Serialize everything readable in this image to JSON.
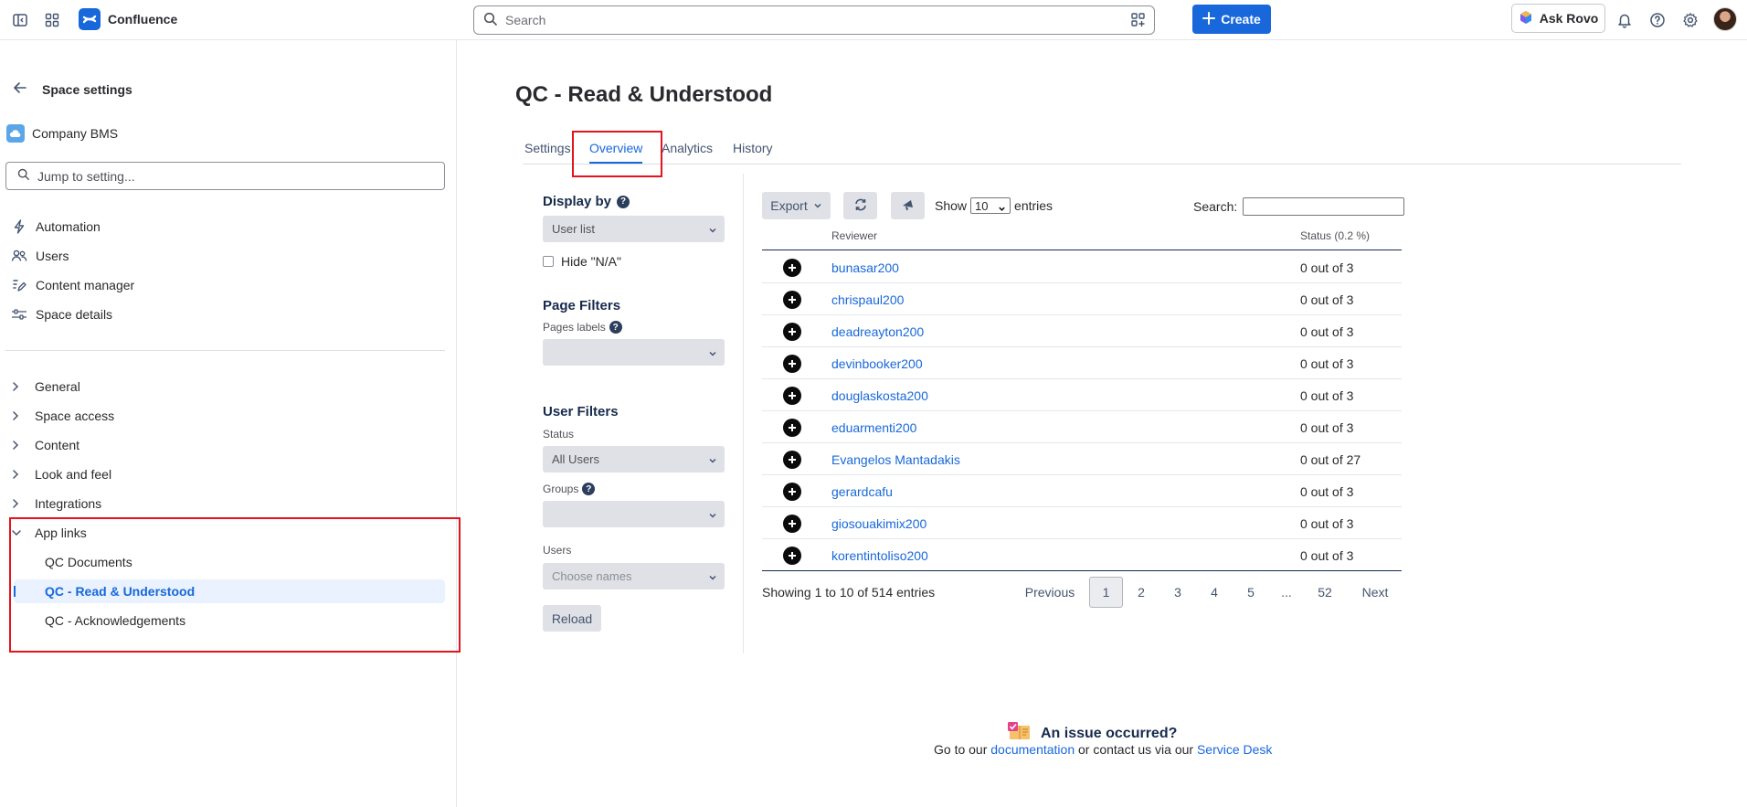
{
  "topbar": {
    "app_name": "Confluence",
    "search_placeholder": "Search",
    "create_label": "Create",
    "rovo_label": "Ask Rovo"
  },
  "sidebar": {
    "back_title": "Space settings",
    "space_name": "Company BMS",
    "jump_placeholder": "Jump to setting...",
    "items": [
      {
        "label": "Automation",
        "icon": "lightning-icon"
      },
      {
        "label": "Users",
        "icon": "people-icon"
      },
      {
        "label": "Content manager",
        "icon": "content-edit-icon"
      },
      {
        "label": "Space details",
        "icon": "sliders-icon"
      }
    ],
    "groups": [
      {
        "label": "General"
      },
      {
        "label": "Space access"
      },
      {
        "label": "Content"
      },
      {
        "label": "Look and feel"
      },
      {
        "label": "Integrations"
      },
      {
        "label": "App links"
      }
    ],
    "app_links": [
      {
        "label": "QC Documents"
      },
      {
        "label": "QC - Read & Understood"
      },
      {
        "label": "QC - Acknowledgements"
      }
    ]
  },
  "main": {
    "title": "QC - Read & Understood",
    "tabs": [
      {
        "label": "Settings"
      },
      {
        "label": "Overview"
      },
      {
        "label": "Analytics"
      },
      {
        "label": "History"
      }
    ],
    "filters": {
      "display_by_title": "Display by",
      "display_by_value": "User list",
      "hide_na_label": "Hide \"N/A\"",
      "page_filters_title": "Page Filters",
      "pages_labels_label": "Pages labels",
      "user_filters_title": "User Filters",
      "status_label": "Status",
      "status_value": "All Users",
      "groups_label": "Groups",
      "users_label": "Users",
      "users_placeholder": "Choose names",
      "reload_label": "Reload"
    },
    "table": {
      "export_label": "Export",
      "show_label": "Show",
      "entries_value": "10",
      "entries_label": "entries",
      "search_label": "Search:",
      "col_reviewer": "Reviewer",
      "col_status": "Status (0.2 %)",
      "rows": [
        {
          "name": "bunasar200",
          "status": "0 out of 3"
        },
        {
          "name": "chrispaul200",
          "status": "0 out of 3"
        },
        {
          "name": "deadreayton200",
          "status": "0 out of 3"
        },
        {
          "name": "devinbooker200",
          "status": "0 out of 3"
        },
        {
          "name": "douglaskosta200",
          "status": "0 out of 3"
        },
        {
          "name": "eduarmenti200",
          "status": "0 out of 3"
        },
        {
          "name": "Evangelos Mantadakis",
          "status": "0 out of 27"
        },
        {
          "name": "gerardcafu",
          "status": "0 out of 3"
        },
        {
          "name": "giosouakimix200",
          "status": "0 out of 3"
        },
        {
          "name": "korentintoliso200",
          "status": "0 out of 3"
        }
      ],
      "showing_text": "Showing 1 to 10 of 514 entries",
      "pagination": {
        "previous": "Previous",
        "pages": [
          "1",
          "2",
          "3",
          "4",
          "5",
          "...",
          "52"
        ],
        "next": "Next"
      }
    },
    "footer": {
      "issue_title": "An issue occurred?",
      "go_to_text": "Go to our",
      "documentation_link": "documentation",
      "contact_text": "or contact us via our",
      "service_desk_link": "Service Desk"
    }
  },
  "colors": {
    "brand_blue": "#1868db",
    "highlight_red": "#e3141b",
    "active_bg": "#e9f2fe"
  }
}
